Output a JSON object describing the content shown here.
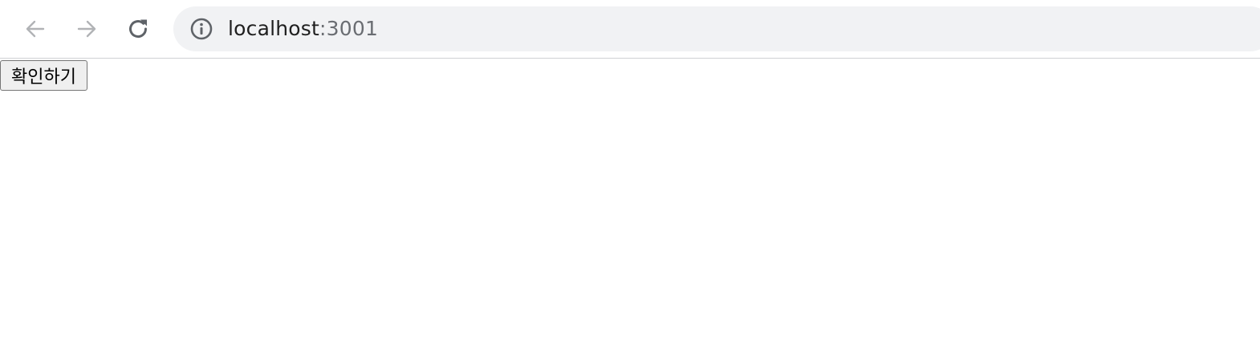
{
  "browser": {
    "back_icon": "arrow-left-icon",
    "forward_icon": "arrow-right-icon",
    "reload_icon": "reload-icon",
    "site_info_icon": "info-circle-icon",
    "url_host": "localhost",
    "url_port": ":3001",
    "colors": {
      "omnibox_bg": "#f1f2f4",
      "nav_disabled": "#b1b3b6",
      "nav_enabled": "#5f6368"
    }
  },
  "page": {
    "confirm_button_label": "확인하기"
  }
}
